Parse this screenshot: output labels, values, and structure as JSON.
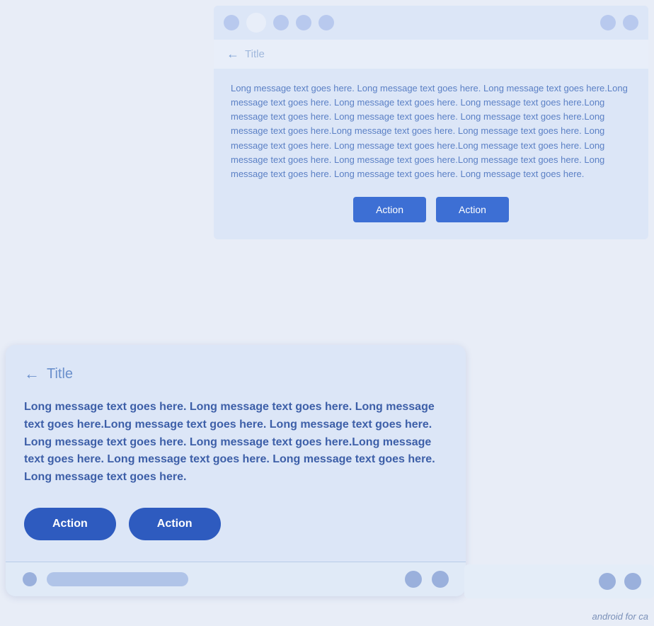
{
  "page": {
    "background": "#e8edf7",
    "watermark": "android for ca"
  },
  "top_card": {
    "statusbar": {
      "dots": [
        "light",
        "white",
        "light",
        "light",
        "light"
      ],
      "right_dots": [
        "light",
        "light"
      ]
    },
    "titlebar": {
      "back_label": "←",
      "title": "Title"
    },
    "body": {
      "message": "Long message text goes here. Long message text goes here. Long message text goes here.Long message text goes here. Long message text goes here. Long message text goes here.Long message text goes here. Long message text goes here. Long message text goes here.Long message text goes here.Long message text goes here. Long message text goes here. Long message text goes here. Long message text goes here.Long message text goes here. Long message text goes here. Long message text goes here.Long message text goes here. Long message text goes here. Long message text goes here. Long message text goes here."
    },
    "buttons": [
      {
        "label": "Action"
      },
      {
        "label": "Action"
      }
    ]
  },
  "bottom_card": {
    "titlebar": {
      "back_label": "←",
      "title": "Title"
    },
    "body": {
      "message": "Long message text goes here. Long message text goes here. Long message text goes here.Long message text goes here. Long message text goes here. Long message text goes here. Long message text goes here.Long message text goes here. Long message text goes here. Long message text goes here. Long message text goes here."
    },
    "buttons": [
      {
        "label": "Action"
      },
      {
        "label": "Action"
      }
    ],
    "nav": {
      "pill_placeholder": ""
    }
  },
  "icons": {
    "back_arrow": "←",
    "chevron": "›"
  }
}
